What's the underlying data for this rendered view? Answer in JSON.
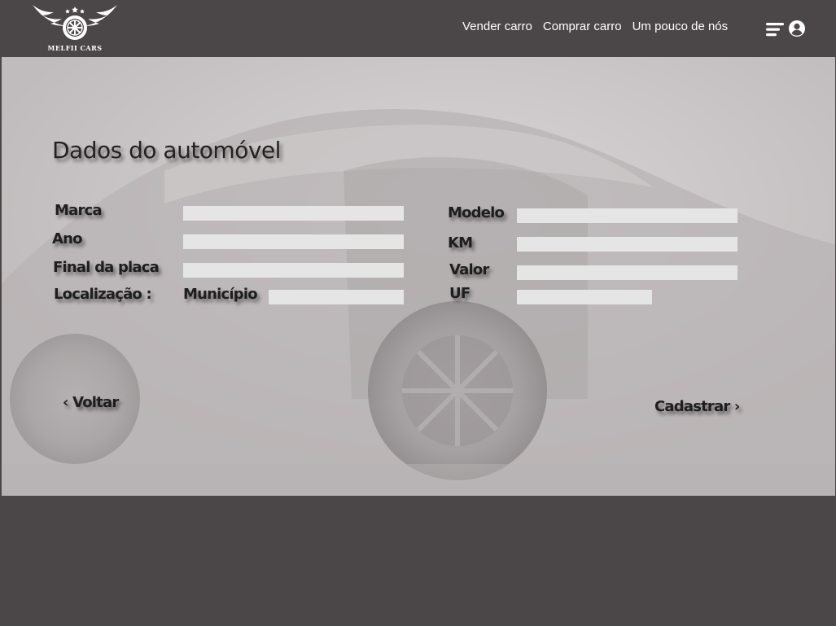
{
  "header": {
    "logo_text": "MELFII CARS",
    "nav": [
      "Vender carro",
      "Comprar carro",
      "Um pouco de nós"
    ],
    "menu_icon": "hamburger-icon",
    "user_icon": "user-circle-icon"
  },
  "form": {
    "title": "Dados do automóvel",
    "labels": {
      "marca": "Marca",
      "ano": "Ano",
      "final_placa": "Final da placa",
      "localizacao": "Localização :",
      "municipio": "Município",
      "modelo": "Modelo",
      "km": "KM",
      "valor": "Valor",
      "uf": "UF"
    },
    "values": {
      "marca": "",
      "ano": "",
      "final_placa": "",
      "municipio": "",
      "modelo": "",
      "km": "",
      "valor": "",
      "uf": ""
    }
  },
  "actions": {
    "back": "Voltar",
    "back_icon": "chevron-left-icon",
    "submit": "Cadastrar",
    "submit_icon": "chevron-right-icon"
  },
  "colors": {
    "header_bg": "#4b4647",
    "hero_bg": "#c4bfc0",
    "field_bg": "#e6e5e5",
    "text": "#1e1e1e"
  }
}
